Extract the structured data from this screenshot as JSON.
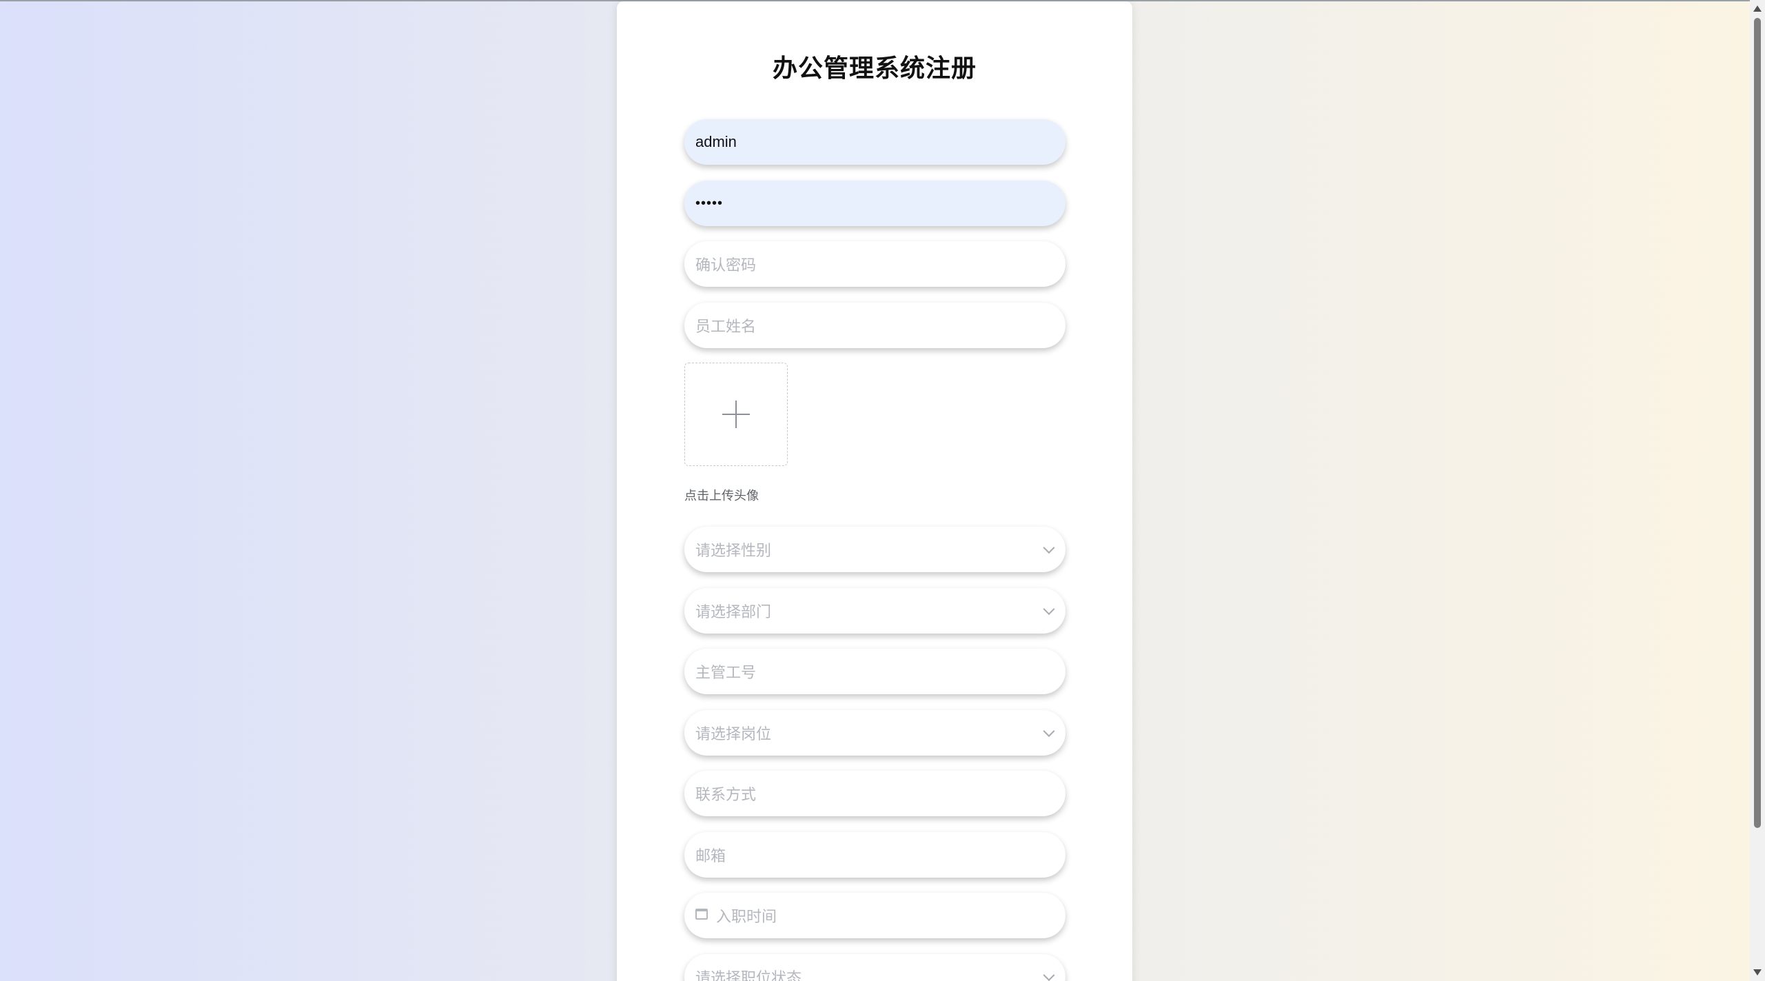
{
  "page": {
    "title": "办公管理系统注册"
  },
  "form": {
    "username": {
      "value": "admin"
    },
    "password": {
      "value": "•••••"
    },
    "confirm_password": {
      "placeholder": "确认密码"
    },
    "employee_name": {
      "placeholder": "员工姓名"
    },
    "avatar_upload": {
      "tip": "点击上传头像"
    },
    "gender": {
      "placeholder": "请选择性别"
    },
    "department": {
      "placeholder": "请选择部门"
    },
    "supervisor_id": {
      "placeholder": "主管工号"
    },
    "position": {
      "placeholder": "请选择岗位"
    },
    "contact": {
      "placeholder": "联系方式"
    },
    "email": {
      "placeholder": "邮箱"
    },
    "hire_date": {
      "placeholder": "入职时间",
      "icon": "calendar-icon"
    },
    "job_status": {
      "placeholder": "请选择职位状态"
    }
  },
  "icons": {
    "upload": "plus-icon",
    "select": "chevron-down-icon"
  },
  "colors": {
    "filled_input_bg": "#e8f0fe",
    "placeholder": "#b4b7bd"
  }
}
